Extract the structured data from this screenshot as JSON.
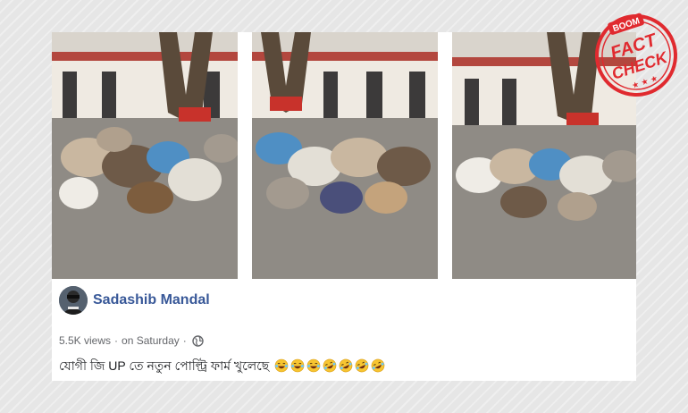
{
  "post": {
    "author": "Sadashib Mandal",
    "views": "5.5K views",
    "separator": "·",
    "time": "on Saturday",
    "privacy_icon": "globe-icon",
    "caption": "যোগী জি UP তে নতুন পোল্ট্রি ফার্ম খুলেছে",
    "emojis": [
      "laughing",
      "laughing",
      "laughing",
      "rofl",
      "rofl",
      "rofl",
      "rofl"
    ]
  },
  "stamp": {
    "top_text": "BOOM",
    "line1": "FACT",
    "line2": "CHECK",
    "color": "#e02a2f"
  },
  "colors": {
    "author_link": "#385898",
    "meta_text": "#65676b",
    "caption_text": "#1c1e21"
  }
}
